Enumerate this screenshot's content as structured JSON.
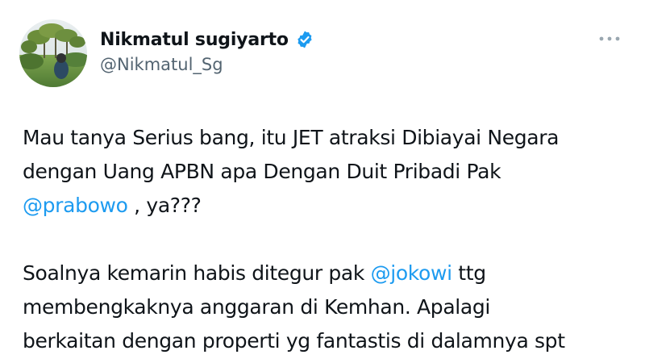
{
  "user": {
    "display_name": "Nikmatul sugiyarto",
    "handle": "@Nikmatul_Sg",
    "verified_icon": "verified-badge-icon",
    "avatar": "profile-photo-field-trees"
  },
  "menu": {
    "icon": "more-options-icon"
  },
  "colors": {
    "text": "#0f1419",
    "secondary": "#536471",
    "link": "#1d9bf0"
  },
  "tweet": {
    "p1": {
      "line1": "Mau tanya Serius bang, itu JET atraksi Dibiayai Negara",
      "line2": "dengan Uang APBN apa Dengan Duit Pribadi Pak",
      "line3_mention": "@prabowo",
      "line3_rest": " , ya???"
    },
    "p2": {
      "line1_text": "Soalnya kemarin habis ditegur pak ",
      "line1_mention": "@jokowi",
      "line1_rest": " ttg",
      "line2": "membengkaknya anggaran di Kemhan. Apalagi",
      "line3": "berkaitan dengan properti yg fantastis di dalamnya spt"
    }
  }
}
